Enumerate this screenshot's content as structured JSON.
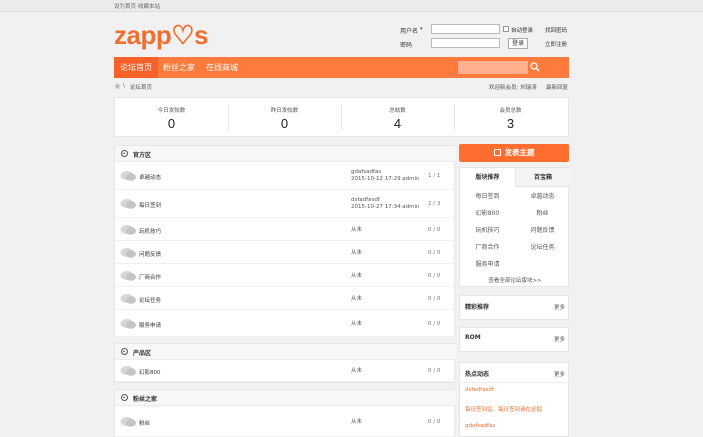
{
  "topbar": {
    "home_link": "设为首页",
    "fav_link": "收藏本站"
  },
  "logo": {
    "text": "zapp♡s"
  },
  "login": {
    "username_label": "用户名",
    "password_label": "密码",
    "auto_login": "自动登录",
    "find_password": "找回密码",
    "login_button": "登录",
    "register_link": "立即注册"
  },
  "nav": {
    "items": [
      {
        "label": "论坛首页"
      },
      {
        "label": "粉丝之家"
      },
      {
        "label": "在线商城"
      }
    ],
    "search_placeholder": ""
  },
  "breadcrumb": {
    "home_icon": "home-icon",
    "sep": "\\",
    "current": "论坛首页"
  },
  "welcome": {
    "text": "欢迎新会员: 刘瑞涛",
    "latest": "最新回复"
  },
  "stats": [
    {
      "label": "今日发帖数",
      "value": "0"
    },
    {
      "label": "昨日发帖数",
      "value": "0"
    },
    {
      "label": "总帖数",
      "value": "4"
    },
    {
      "label": "会员总数",
      "value": "3"
    }
  ],
  "sections": [
    {
      "title": "官方区",
      "forums": [
        {
          "name": "卓越动态",
          "count": "1 / 1",
          "last1": "gdafsadfas",
          "last2": "2015-10-12 17:29 admin"
        },
        {
          "name": "每日签到",
          "count": "2 / 3",
          "last1": "dsfadfasdf",
          "last2": "2015-10-27 17:34 admin"
        },
        {
          "name": "玩机技巧",
          "count": "0 / 0",
          "last1": "从未",
          "last2": ""
        },
        {
          "name": "问题反馈",
          "count": "0 / 0",
          "last1": "从未",
          "last2": ""
        },
        {
          "name": "厂商合作",
          "count": "0 / 0",
          "last1": "从未",
          "last2": ""
        },
        {
          "name": "论坛任务",
          "count": "0 / 0",
          "last1": "从未",
          "last2": ""
        },
        {
          "name": "服务申请",
          "count": "0 / 0",
          "last1": "从未",
          "last2": ""
        }
      ]
    },
    {
      "title": "产品区",
      "forums": [
        {
          "name": "幻影800",
          "count": "0 / 0",
          "last1": "从未",
          "last2": ""
        }
      ]
    },
    {
      "title": "粉丝之家",
      "forums": [
        {
          "name": "粉丝",
          "count": "0 / 0",
          "last1": "从未",
          "last2": ""
        }
      ]
    }
  ],
  "sidebar": {
    "post_button": "发表主题",
    "tabs": [
      "版块推荐",
      "百宝箱"
    ],
    "cells": [
      "每日签到",
      "卓越动态",
      "幻影800",
      "粉丝",
      "玩机技巧",
      "问题反馈",
      "厂商合作",
      "论坛任务",
      "服务申请"
    ],
    "view_all": "查看全部论坛版块>>",
    "boxes": [
      {
        "title": "精彩推荐",
        "more": "更多"
      },
      {
        "title": "ROM",
        "more": "更多"
      },
      {
        "title": "热点动态",
        "more": "更多"
      }
    ],
    "hot_items": [
      "dsfadfasdf",
      "每日签到站，每日签到请在此贴",
      "gdafsadfas"
    ]
  },
  "colors": {
    "accent": "#ff7a3d",
    "accent_dark": "#f56128",
    "link": "#f06e30"
  }
}
